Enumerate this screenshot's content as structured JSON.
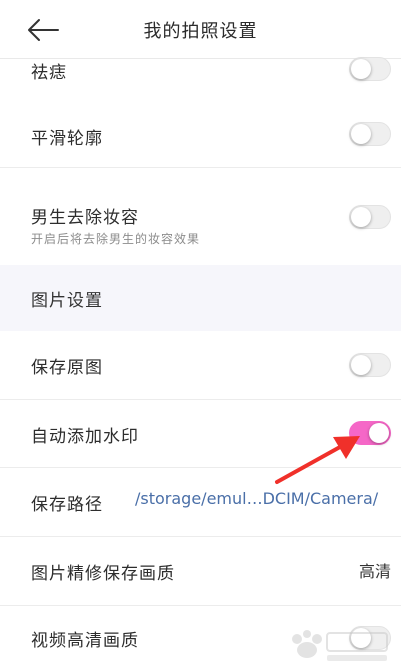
{
  "header": {
    "title": "我的拍照设置",
    "back_icon": "back-arrow-icon"
  },
  "rows": [
    {
      "label": "祛痣",
      "toggle": "off"
    },
    {
      "label": "平滑轮廓",
      "toggle": "off"
    },
    {
      "label": "男生去除妆容",
      "sub": "开启后将去除男生的妆容效果",
      "toggle": "off"
    },
    {
      "section": "图片设置"
    },
    {
      "label": "保存原图",
      "toggle": "off"
    },
    {
      "label": "自动添加水印",
      "toggle": "on"
    },
    {
      "label": "保存路径",
      "value": "/storage/emul…DCIM/Camera/"
    },
    {
      "label": "图片精修保存画质",
      "value": "高清"
    },
    {
      "label": "视频高清画质",
      "toggle": "off"
    }
  ],
  "colors": {
    "toggle_on": "#f567c7",
    "toggle_off": "#efefef",
    "section_bg": "#f6f6fb",
    "path_text": "#4a6fa8",
    "annotation_arrow": "#f0302a"
  }
}
